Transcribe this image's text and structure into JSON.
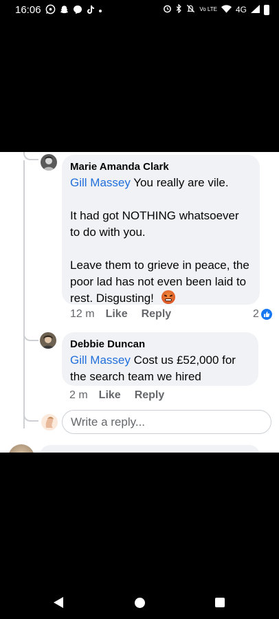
{
  "status_bar": {
    "time": "16:06",
    "left_icons": [
      "whatsapp-icon",
      "snapchat-icon",
      "messenger-icon",
      "tiktok-icon"
    ],
    "right_icons": [
      "alarm-icon",
      "bluetooth-icon",
      "mute-icon",
      "volte-icon",
      "wifi-icon",
      "signal-icon",
      "battery-icon"
    ],
    "volte_label": "Vo LTE",
    "network": "4G"
  },
  "comments": [
    {
      "author": "Marie Amanda Clark",
      "mention": "Gill Massey",
      "first_line": "You really are vile.",
      "paragraph_2": "It had got NOTHING whatsoever to do with you.",
      "paragraph_3": "Leave them to grieve in peace, the poor lad has not even been laid to rest. Disgusting!",
      "emoji": "angry-face-emoji",
      "time": "12 m",
      "like_label": "Like",
      "reply_label": "Reply",
      "reaction_count": "2",
      "reaction_type": "like"
    },
    {
      "author": "Debbie Duncan",
      "mention": "Gill Massey",
      "text": "Cost us £52,000 for the search team we hired",
      "time": "2 m",
      "like_label": "Like",
      "reply_label": "Reply"
    }
  ],
  "reply_box": {
    "placeholder": "Write a reply..."
  },
  "colors": {
    "mention": "#216fdb",
    "bubble": "#f0f2f5",
    "meta": "#65676b",
    "like_badge": "#1877f2"
  },
  "nav": {
    "back": "back-icon",
    "home": "home-icon",
    "recents": "recents-icon"
  }
}
